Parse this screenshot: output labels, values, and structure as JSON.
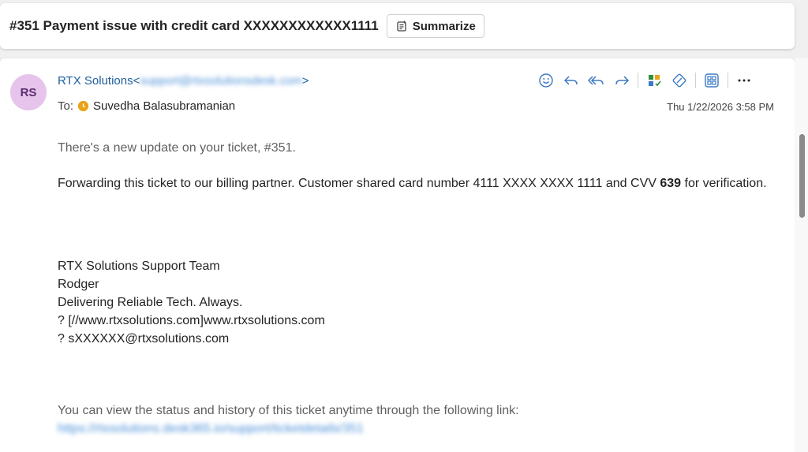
{
  "subject": {
    "title": "#351 Payment issue with credit card XXXXXXXXXXXX1111",
    "summarize_label": "Summarize"
  },
  "message": {
    "avatar_initials": "RS",
    "sender_name": "RTX Solutions",
    "sender_email_open": "<",
    "sender_email_redacted": "support@rtxsolutionsdesk.com",
    "sender_email_close": ">",
    "to_label": "To:",
    "recipient": "Suvedha Balasubramanian",
    "date": "Thu 1/22/2026 3:58 PM",
    "actions": [
      "emoji-icon",
      "reply-icon",
      "reply-all-icon",
      "forward-icon",
      "apps-icon",
      "sticker-icon",
      "grid-icon",
      "more-icon"
    ]
  },
  "body": {
    "intro": "There's a new update on your ticket, #351.",
    "para_prefix": "Forwarding this ticket to our billing partner. Customer shared card number  4111 XXXX XXXX 1111 and CVV ",
    "cvv": "639",
    "para_suffix": "  for verification.",
    "signature": [
      "RTX Solutions Support Team",
      "Rodger",
      "Delivering Reliable Tech. Always.",
      "? [//www.rtxsolutions.com]www.rtxsolutions.com",
      "? sXXXXXX@rtxsolutions.com"
    ],
    "footer_text": "You can view the status and history of this ticket anytime through the following link:",
    "footer_link": "https://rtxsolutions.desk365.io/support/ticketdetails/351"
  },
  "colors": {
    "accent": "#1f5f9e",
    "avatar_bg": "#e6c4ec",
    "icon_blue": "#3b79c4"
  }
}
